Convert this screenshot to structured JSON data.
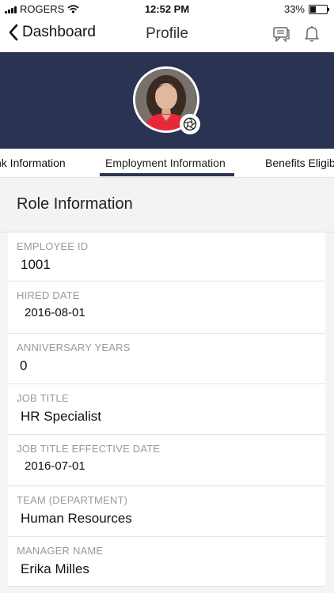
{
  "status_bar": {
    "carrier": "ROGERS",
    "time": "12:52 PM",
    "battery_text": "33%",
    "battery_level": 0.33
  },
  "nav": {
    "back_label": "Dashboard",
    "title": "Profile",
    "icons": [
      "chat-icon",
      "bell-icon"
    ]
  },
  "header": {
    "band_color": "#2b3352",
    "avatar_icon": "camera-aperture-icon"
  },
  "tabs": [
    {
      "label": "nk Information"
    },
    {
      "label": "Employment Information",
      "active": true
    },
    {
      "label": "Benefits Eligib"
    }
  ],
  "section": {
    "title": "Role Information",
    "fields": [
      {
        "label": "EMPLOYEE ID",
        "value": "1001"
      },
      {
        "label": "HIRED DATE",
        "value": "2016-08-01"
      },
      {
        "label": "ANNIVERSARY YEARS",
        "value": "0"
      },
      {
        "label": "JOB TITLE",
        "value": "HR Specialist"
      },
      {
        "label": "JOB TITLE EFFECTIVE DATE",
        "value": "2016-07-01"
      },
      {
        "label": "TEAM (DEPARTMENT)",
        "value": "Human Resources"
      },
      {
        "label": "MANAGER NAME",
        "value": "Erika Milles"
      }
    ]
  }
}
